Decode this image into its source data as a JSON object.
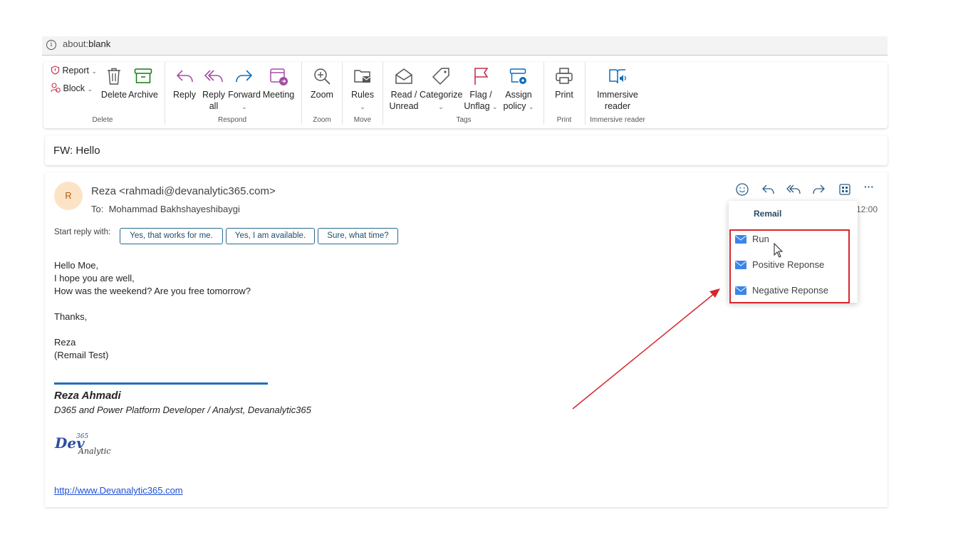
{
  "browser": {
    "url_prefix": "about:",
    "url_suffix": "blank",
    "info_glyph": "i"
  },
  "ribbon": {
    "report": "Report",
    "block": "Block",
    "delete": "Delete",
    "archive": "Archive",
    "reply": "Reply",
    "reply_all_1": "Reply",
    "reply_all_2": "all",
    "forward": "Forward",
    "meeting": "Meeting",
    "zoom": "Zoom",
    "rules": "Rules",
    "read_1": "Read /",
    "read_2": "Unread",
    "categorize": "Categorize",
    "flag_1": "Flag /",
    "flag_2": "Unflag",
    "assign_1": "Assign",
    "assign_2": "policy",
    "print": "Print",
    "immersive_1": "Immersive",
    "immersive_2": "reader",
    "groups": {
      "delete": "Delete",
      "respond": "Respond",
      "zoom": "Zoom",
      "move": "Move",
      "tags": "Tags",
      "print": "Print",
      "immersive": "Immersive reader"
    },
    "caret": "⌄"
  },
  "subject": "FW: Hello",
  "message": {
    "avatar_initial": "R",
    "from": "Reza <rahmadi@devanalytic365.com>",
    "to_label": "To:",
    "to_name": "Mohammad Bakhshayeshibaygi",
    "time": "12:00",
    "more": "···",
    "start_reply_label": "Start reply with:",
    "suggestions": [
      "Yes, that works for me.",
      "Yes, I am available.",
      "Sure, what time?"
    ],
    "body_lines": [
      "Hello Moe,",
      "I hope you are well,",
      "How was the weekend? Are you free tomorrow?",
      "",
      "Thanks,",
      "",
      "Reza",
      "(Remail Test)"
    ],
    "signature_name": "Reza Ahmadi",
    "signature_title": "D365 and Power Platform Developer / Analyst, Devanalytic365",
    "logo_text_1": "Dev",
    "logo_text_2": "365",
    "logo_text_3": "Analytic",
    "link": "http://www.Devanalytic365.com"
  },
  "dropdown": {
    "header": "Remail",
    "items": [
      "Run",
      "Positive Reponse",
      "Negative Reponse"
    ]
  },
  "colors": {
    "accent": "#0f6cbd",
    "annotation_red": "#d8262c",
    "flag_red": "#c4314b",
    "archive_green": "#107c10"
  }
}
